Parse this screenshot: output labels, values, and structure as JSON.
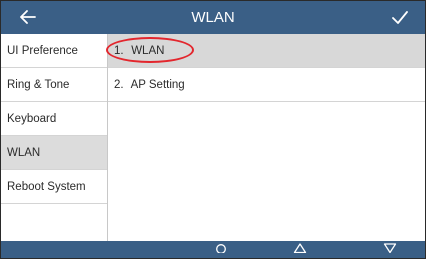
{
  "header": {
    "title": "WLAN",
    "back_icon": "arrow-left-icon",
    "confirm_icon": "checkmark-icon"
  },
  "sidebar": {
    "items": [
      {
        "label": "UI Preference",
        "active": false
      },
      {
        "label": "Ring & Tone",
        "active": false
      },
      {
        "label": "Keyboard",
        "active": false
      },
      {
        "label": "WLAN",
        "active": true
      },
      {
        "label": "Reboot System",
        "active": false
      }
    ]
  },
  "main": {
    "items": [
      {
        "number": "1.",
        "label": "WLAN",
        "active": true
      },
      {
        "number": "2.",
        "label": "AP Setting",
        "active": false
      }
    ]
  },
  "softkeys": {
    "icons": [
      "circle-icon",
      "triangle-up-icon",
      "triangle-down-icon"
    ]
  },
  "colors": {
    "bar": "#3a5f86",
    "selected_row": "#d8d8d8",
    "annotation": "#e3262d"
  }
}
